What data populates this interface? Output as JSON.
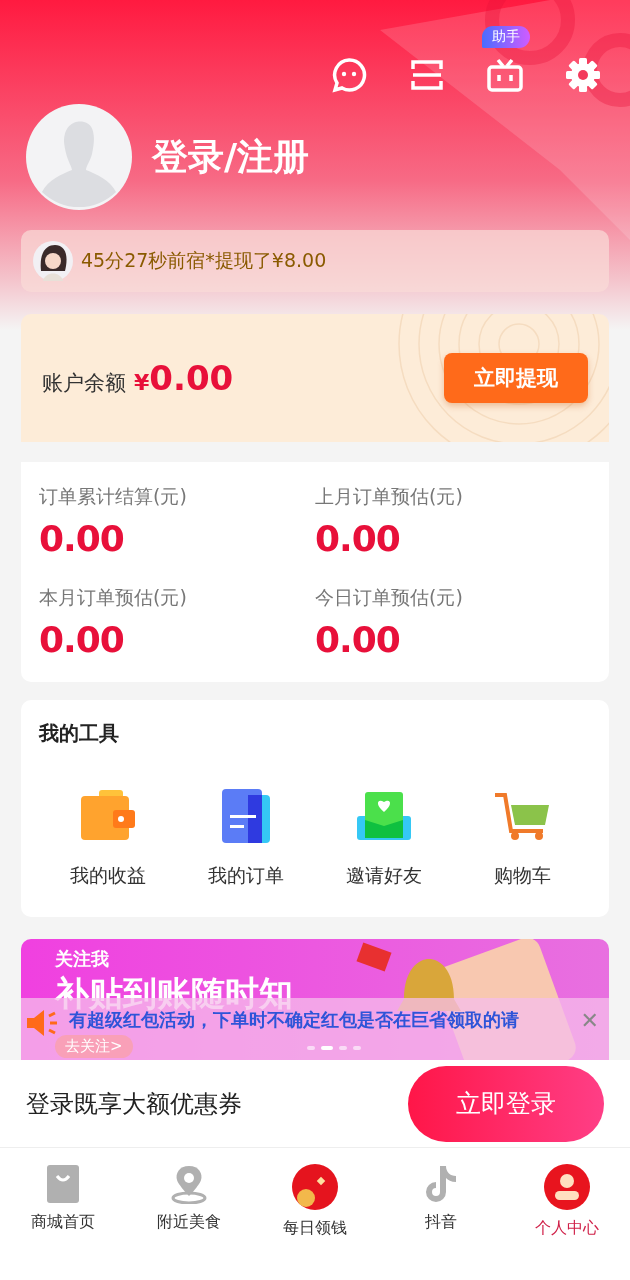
{
  "header": {
    "assistant_badge": "助手",
    "login_title": "登录/注册"
  },
  "ticker": {
    "text": "45分27秒前宿*提现了¥8.00"
  },
  "balance": {
    "label": "账户余额",
    "currency": "¥",
    "amount": "0.00",
    "button": "立即提现"
  },
  "stats": [
    {
      "label": "订单累计结算(元)",
      "value": "0.00"
    },
    {
      "label": "上月订单预估(元)",
      "value": "0.00"
    },
    {
      "label": "本月订单预估(元)",
      "value": "0.00"
    },
    {
      "label": "今日订单预估(元)",
      "value": "0.00"
    }
  ],
  "tools": {
    "title": "我的工具",
    "items": [
      {
        "kind": "wallet",
        "label": "我的收益"
      },
      {
        "kind": "orders",
        "label": "我的订单"
      },
      {
        "kind": "invite",
        "label": "邀请好友"
      },
      {
        "kind": "cart",
        "label": "购物车"
      }
    ]
  },
  "banner": {
    "subtitle": "关注我",
    "title": "补贴到账随时知",
    "action": "去关注>",
    "dots": [
      {
        "selected": false
      },
      {
        "selected": true
      },
      {
        "selected": false
      },
      {
        "selected": false
      }
    ]
  },
  "notice": {
    "text": "有超级红包活动，下单时不确定红包是否在巨省领取的请",
    "close": "✕"
  },
  "login_bar": {
    "text": "登录既享大额优惠券",
    "button": "立即登录"
  },
  "nav": [
    {
      "kind": "shop",
      "label": "商城首页",
      "selected": false
    },
    {
      "kind": "location",
      "label": "附近美食",
      "selected": false
    },
    {
      "kind": "money",
      "label": "每日领钱",
      "selected": false
    },
    {
      "kind": "music",
      "label": "抖音",
      "selected": false
    },
    {
      "kind": "profile",
      "label": "个人中心",
      "selected": true
    }
  ]
}
